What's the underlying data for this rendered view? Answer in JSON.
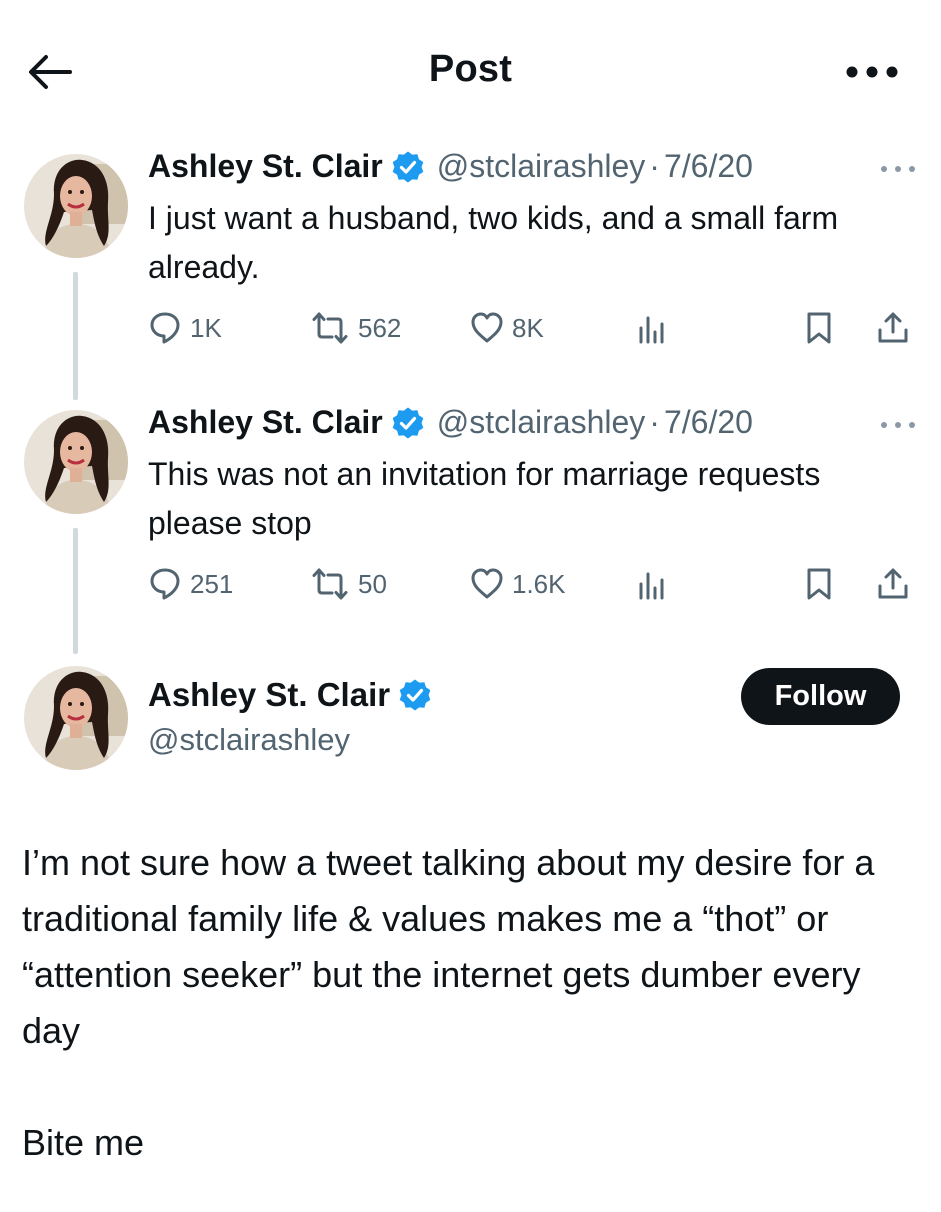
{
  "header": {
    "title": "Post",
    "back_icon": "arrow-left-icon",
    "more_icon": "more-horizontal-icon"
  },
  "colors": {
    "text_primary": "#0f1419",
    "text_secondary": "#536471",
    "verified_blue": "#1d9bf0",
    "thread_line": "#cfd9de",
    "follow_bg": "#0f1419"
  },
  "thread": [
    {
      "author": {
        "name": "Ashley St. Clair",
        "handle": "@stclairashley",
        "verified": true
      },
      "separator": "·",
      "date": "7/6/20",
      "text": "I just want a husband, two kids, and a small farm already.",
      "stats": {
        "replies": "1K",
        "reposts": "562",
        "likes": "8K"
      }
    },
    {
      "author": {
        "name": "Ashley St. Clair",
        "handle": "@stclairashley",
        "verified": true
      },
      "separator": "·",
      "date": "7/6/20",
      "text": "This was not an invitation for marriage requests please stop",
      "stats": {
        "replies": "251",
        "reposts": "50",
        "likes": "1.6K"
      }
    }
  ],
  "main_post": {
    "author": {
      "name": "Ashley St. Clair",
      "handle": "@stclairashley",
      "verified": true
    },
    "follow_label": "Follow",
    "paragraphs": [
      "I’m not sure how a tweet talking about my desire for a traditional family life & values makes me a “thot” or “attention seeker” but the internet gets dumber every day",
      "Bite me"
    ]
  }
}
